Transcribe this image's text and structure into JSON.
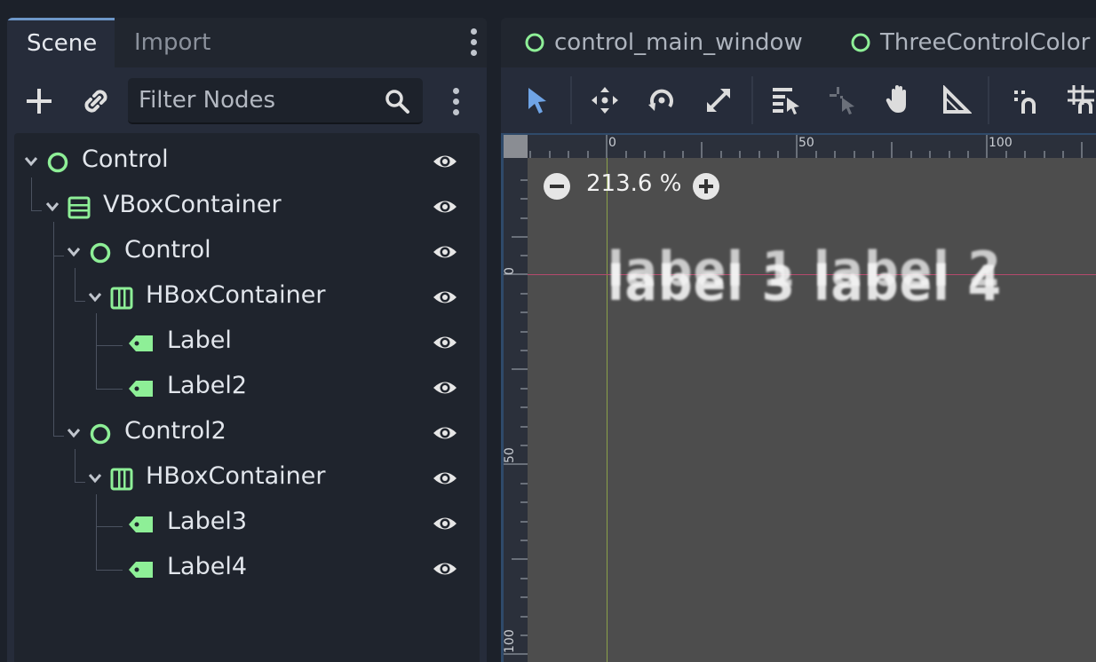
{
  "scene_dock": {
    "tabs": [
      {
        "label": "Scene",
        "active": true
      },
      {
        "label": "Import",
        "active": false
      }
    ],
    "toolbar": {
      "add_icon": "plus-icon",
      "link_icon": "link-icon",
      "filter_placeholder": "Filter Nodes",
      "search_icon": "search-icon"
    },
    "tree": [
      {
        "label": "Control",
        "type": "control",
        "depth": 0
      },
      {
        "label": "VBoxContainer",
        "type": "vbox",
        "depth": 1
      },
      {
        "label": "Control",
        "type": "control",
        "depth": 2
      },
      {
        "label": "HBoxContainer",
        "type": "hbox",
        "depth": 3
      },
      {
        "label": "Label",
        "type": "label",
        "depth": 4
      },
      {
        "label": "Label2",
        "type": "label",
        "depth": 4
      },
      {
        "label": "Control2",
        "type": "control",
        "depth": 2
      },
      {
        "label": "HBoxContainer",
        "type": "hbox",
        "depth": 3
      },
      {
        "label": "Label3",
        "type": "label",
        "depth": 4
      },
      {
        "label": "Label4",
        "type": "label",
        "depth": 4
      }
    ]
  },
  "editor": {
    "scene_tabs": [
      {
        "label": "control_main_window"
      },
      {
        "label": "ThreeControlColor"
      }
    ],
    "toolbar_icons": [
      "select-icon",
      "move-icon",
      "rotate-icon",
      "scale-icon",
      "list-select-icon",
      "pivot-icon",
      "pan-icon",
      "ruler-icon",
      "smart-snap-icon",
      "grid-snap-icon"
    ],
    "ruler_top": [
      "0",
      "50",
      "100"
    ],
    "ruler_left": [
      "0",
      "50",
      "100"
    ],
    "zoom": "213.6 %",
    "canvas_labels": [
      "label 1",
      "label 2",
      "label 3",
      "label 4"
    ]
  },
  "colors": {
    "node_green": "#8eef97",
    "accent_blue": "#6d97c9",
    "canvas_bg": "#4d4d4d",
    "guide_red": "#b44a6d",
    "guide_green": "#8aa14a"
  }
}
